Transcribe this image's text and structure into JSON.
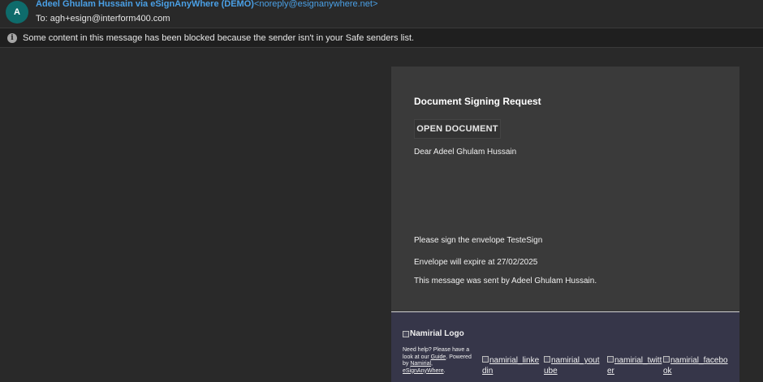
{
  "header": {
    "avatar_letter": "A",
    "sender_name": "Adeel Ghulam Hussain via eSignAnyWhere (DEMO)",
    "sender_email": "<noreply@esignanywhere.net>",
    "to_label": "To:",
    "to_address": "agh+esign@interform400.com"
  },
  "notice": {
    "icon": "info-icon",
    "text": "Some content in this message has been blocked because the sender isn't in your Safe senders list."
  },
  "email": {
    "title": "Document Signing Request",
    "open_button": "OPEN DOCUMENT",
    "greeting": "Dear Adeel Ghulam Hussain",
    "sign_line": "Please sign the envelope TesteSign",
    "expire_line": "Envelope will expire at 27/02/2025",
    "sent_by_line": "This message was sent by Adeel Ghulam Hussain."
  },
  "footer": {
    "logo_alt": "Namirial Logo",
    "help_prefix": "Need help? Please have a look at our",
    "guide_link": "Guide",
    "powered_by": ". Powered by",
    "namirial_link": "Namirial",
    "esign_link": "eSignAnyWhere",
    "social": [
      "namirial_linkedin",
      "namirial_youtube",
      "namirial_twitter",
      "namirial_facebook"
    ]
  },
  "colors": {
    "background": "#292929",
    "card": "#3a3a3a",
    "footer": "#363649",
    "sender_link": "#4aa0e6",
    "avatar": "#0e6b6b"
  }
}
